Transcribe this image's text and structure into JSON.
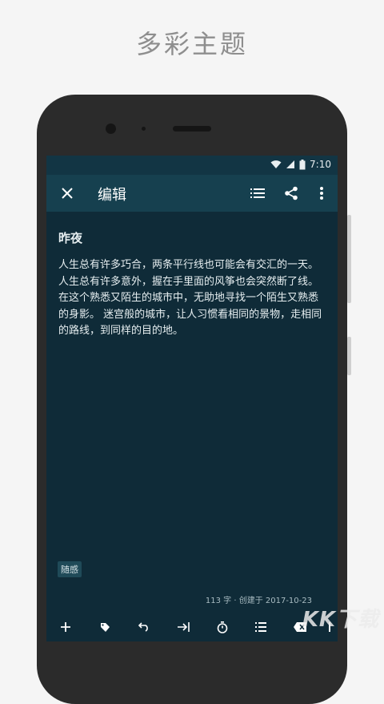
{
  "banner": {
    "title": "多彩主题"
  },
  "status_bar": {
    "time": "7:10"
  },
  "app_bar": {
    "title": "编辑",
    "icons": [
      "close-icon",
      "list-icon",
      "share-icon",
      "more-vert-icon"
    ]
  },
  "note": {
    "title": "昨夜",
    "body": "人生总有许多巧合，两条平行线也可能会有交汇的一天。人生总有许多意外，握在手里面的风筝也会突然断了线。在这个熟悉又陌生的城市中，无助地寻找一个陌生又熟悉的身影。 迷宫般的城市，让人习惯看相同的景物，走相同的路线，到同样的目的地。",
    "tag": "随感",
    "meta": "113 字 · 创建于 2017-10-23"
  },
  "toolbar": {
    "icons": [
      "add-icon",
      "tag-icon",
      "undo-icon",
      "indent-icon",
      "timer-icon",
      "list-icon",
      "backspace-icon",
      "more-icon"
    ]
  },
  "watermark": {
    "text": "KK下载"
  },
  "colors": {
    "screen_bg": "#0f2b38",
    "appbar_bg": "#16404f",
    "statusbar_bg": "#123544",
    "text": "#e6eef0"
  }
}
